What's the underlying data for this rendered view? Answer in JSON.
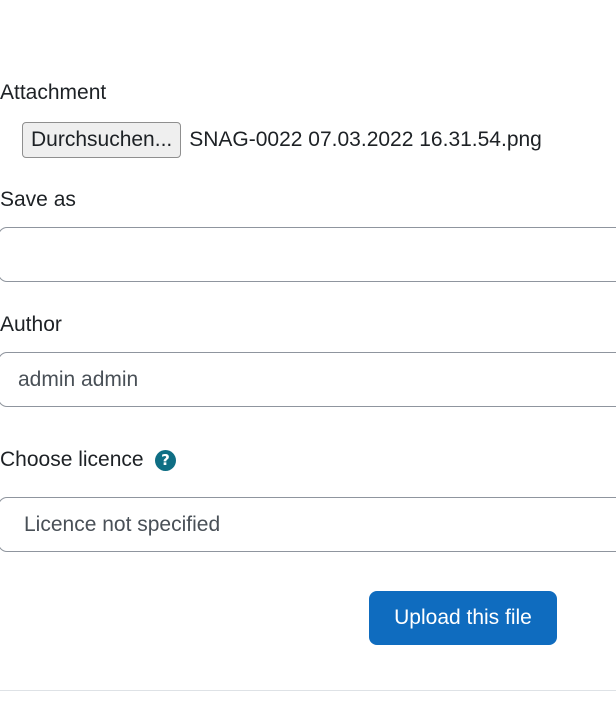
{
  "attachment": {
    "label": "Attachment",
    "browse_button": "Durchsuchen...",
    "file_name": "SNAG-0022 07.03.2022 16.31.54.png"
  },
  "save_as": {
    "label": "Save as",
    "value": ""
  },
  "author": {
    "label": "Author",
    "value": "admin admin"
  },
  "licence": {
    "label": "Choose licence",
    "help_icon": "question-circle-icon",
    "help_glyph": "?",
    "selected": "Licence not specified"
  },
  "upload_button": {
    "label": "Upload this file",
    "color": "#0f6cbf"
  },
  "colors": {
    "help_icon": "#0f6e84",
    "text": "#1d2125"
  }
}
